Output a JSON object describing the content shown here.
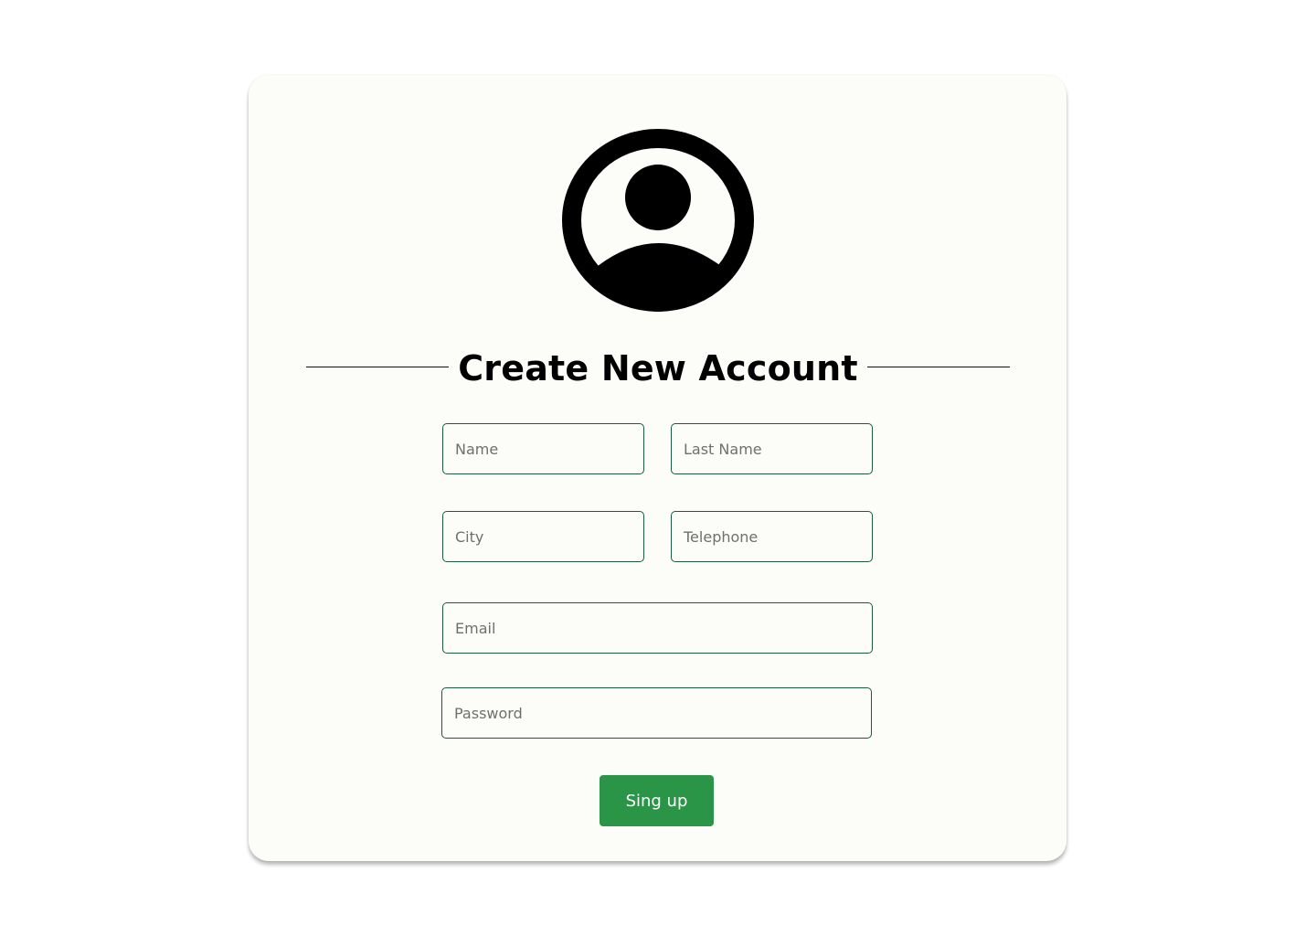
{
  "form": {
    "title": "Create New Account",
    "avatar_icon": "user-circle-icon",
    "fields": {
      "name": {
        "placeholder": "Name",
        "value": ""
      },
      "last_name": {
        "placeholder": "Last Name",
        "value": ""
      },
      "city": {
        "placeholder": "City",
        "value": ""
      },
      "telephone": {
        "placeholder": "Telephone",
        "value": ""
      },
      "email": {
        "placeholder": "Email",
        "value": ""
      },
      "password": {
        "placeholder": "Password",
        "value": ""
      }
    },
    "submit_label": "Sing up"
  },
  "colors": {
    "card_background": "#fcfdf8",
    "field_border": "#1a5a3e",
    "button_background": "#2a9547",
    "button_text": "#ffffff"
  }
}
